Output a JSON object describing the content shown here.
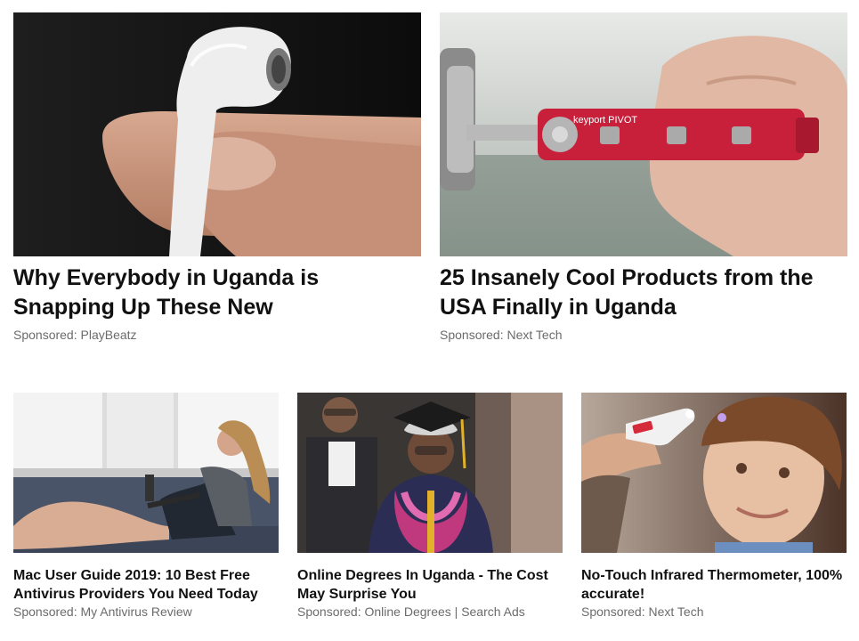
{
  "cards": [
    {
      "headline": "Why Everybody in Uganda is Snapping Up These New",
      "sponsor": "Sponsored: PlayBeatz",
      "image": "earbud-photo"
    },
    {
      "headline": "25 Insanely Cool Products from the USA Finally in Uganda",
      "sponsor": "Sponsored: Next Tech",
      "image": "key-organizer-photo",
      "image_text": "keyport PIVOT"
    },
    {
      "headline": "Mac User Guide 2019: 10 Best Free Antivirus Providers You Need Today",
      "sponsor": "Sponsored: My Antivirus Review",
      "image": "woman-laptop-couch-photo"
    },
    {
      "headline": "Online Degrees In Uganda - The Cost May Surprise You",
      "sponsor": "Sponsored: Online Degrees | Search Ads",
      "image": "graduate-photo"
    },
    {
      "headline": "No-Touch Infrared Thermometer, 100% accurate!",
      "sponsor": "Sponsored: Next Tech",
      "image": "thermometer-child-photo"
    }
  ]
}
